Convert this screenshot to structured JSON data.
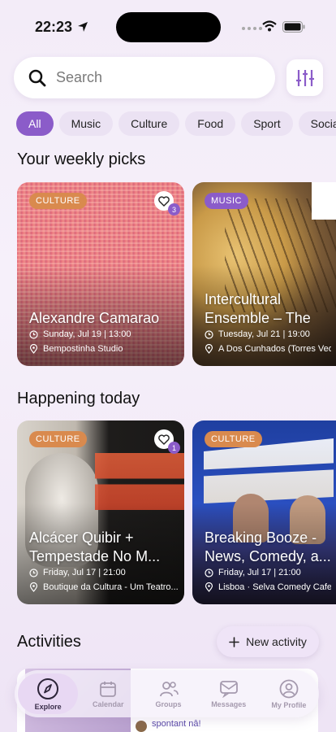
{
  "status": {
    "time": "22:23"
  },
  "search": {
    "placeholder": "Search"
  },
  "chips": [
    "All",
    "Music",
    "Culture",
    "Food",
    "Sport",
    "Social"
  ],
  "sections": {
    "weekly": "Your weekly picks",
    "today": "Happening today",
    "activities": "Activities"
  },
  "weekly_cards": [
    {
      "badge": "CULTURE",
      "title": "Alexandre Camarao",
      "date": "Sunday, Jul 19 | 13:00",
      "place": "Bempostinha Studio",
      "likes": "3"
    },
    {
      "badge": "MUSIC",
      "title": "Intercultural Ensemble – The R...",
      "date": "Tuesday, Jul 21 | 19:00",
      "place": "A Dos Cunhados (Torres Vedr..."
    }
  ],
  "today_cards": [
    {
      "badge": "CULTURE",
      "title": "Alcácer Quibir + Tempestade No M...",
      "date": "Friday, Jul 17 | 21:00",
      "place": "Boutique da Cultura - Um Teatro...",
      "likes": "1"
    },
    {
      "badge": "CULTURE",
      "title": "Breaking Booze - News, Comedy, a...",
      "date": "Friday, Jul 17 | 21:00",
      "place": "Lisboa · Selva Comedy Cafe"
    }
  ],
  "new_activity": "New activity",
  "activity_peek": "spontant nâ!",
  "tabs": [
    "Explore",
    "Calendar",
    "Groups",
    "Messages",
    "My Profile"
  ],
  "colors": {
    "accent": "#8b5cc9",
    "culture": "#d98a4e",
    "background": "#f3ecf8"
  }
}
